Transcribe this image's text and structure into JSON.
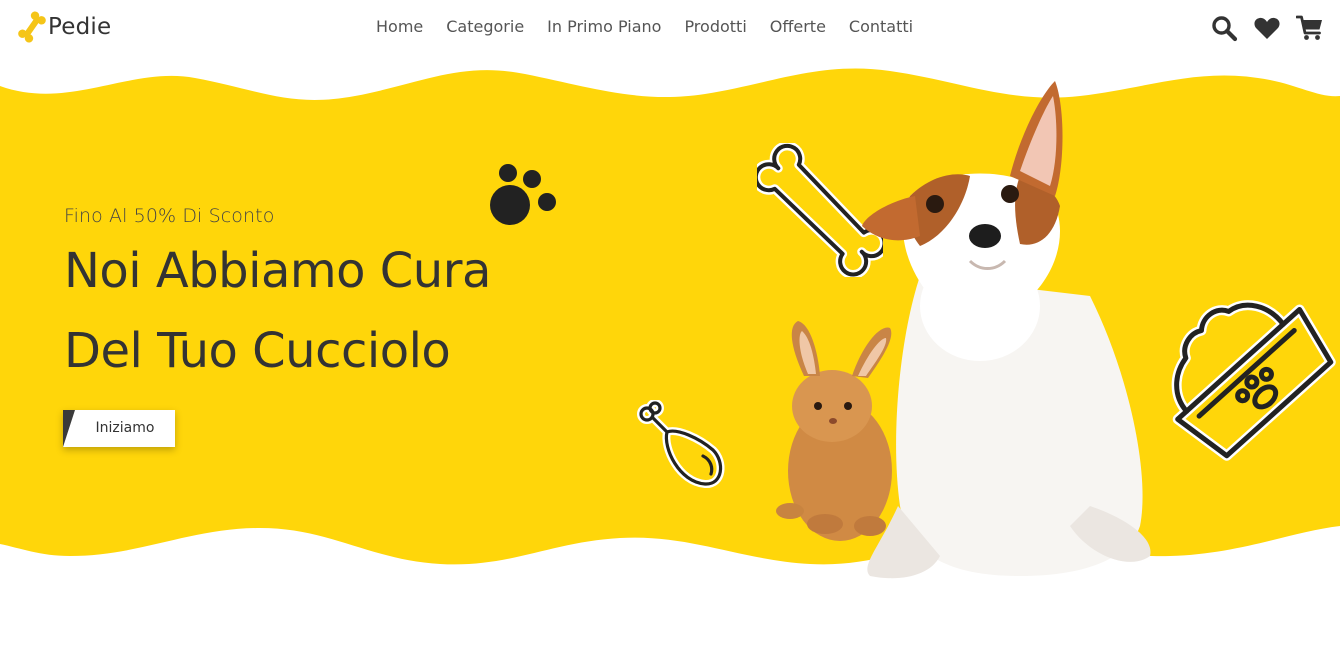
{
  "header": {
    "logo": {
      "text": "Pedie",
      "icon": "bone-icon"
    },
    "nav": [
      {
        "label": "Home"
      },
      {
        "label": "Categorie"
      },
      {
        "label": "In Primo Piano"
      },
      {
        "label": "Prodotti"
      },
      {
        "label": "Offerte"
      },
      {
        "label": "Contatti"
      }
    ],
    "icons": [
      "search-icon",
      "heart-icon",
      "cart-icon"
    ]
  },
  "hero": {
    "subtitle": "Fino Al 50% Di Sconto",
    "title_line1": "Noi Abbiamo Cura",
    "title_line2": "Del Tuo Cucciolo",
    "cta_label": "Iniziamo",
    "decorations": [
      "paw-icon",
      "bone-icon",
      "drumstick-icon",
      "food-bowl-icon"
    ],
    "image": "puppy-and-rabbit"
  },
  "colors": {
    "accent": "#FFD60A",
    "text_dark": "#333333",
    "nav_text": "#555555",
    "white": "#FFFFFF"
  }
}
